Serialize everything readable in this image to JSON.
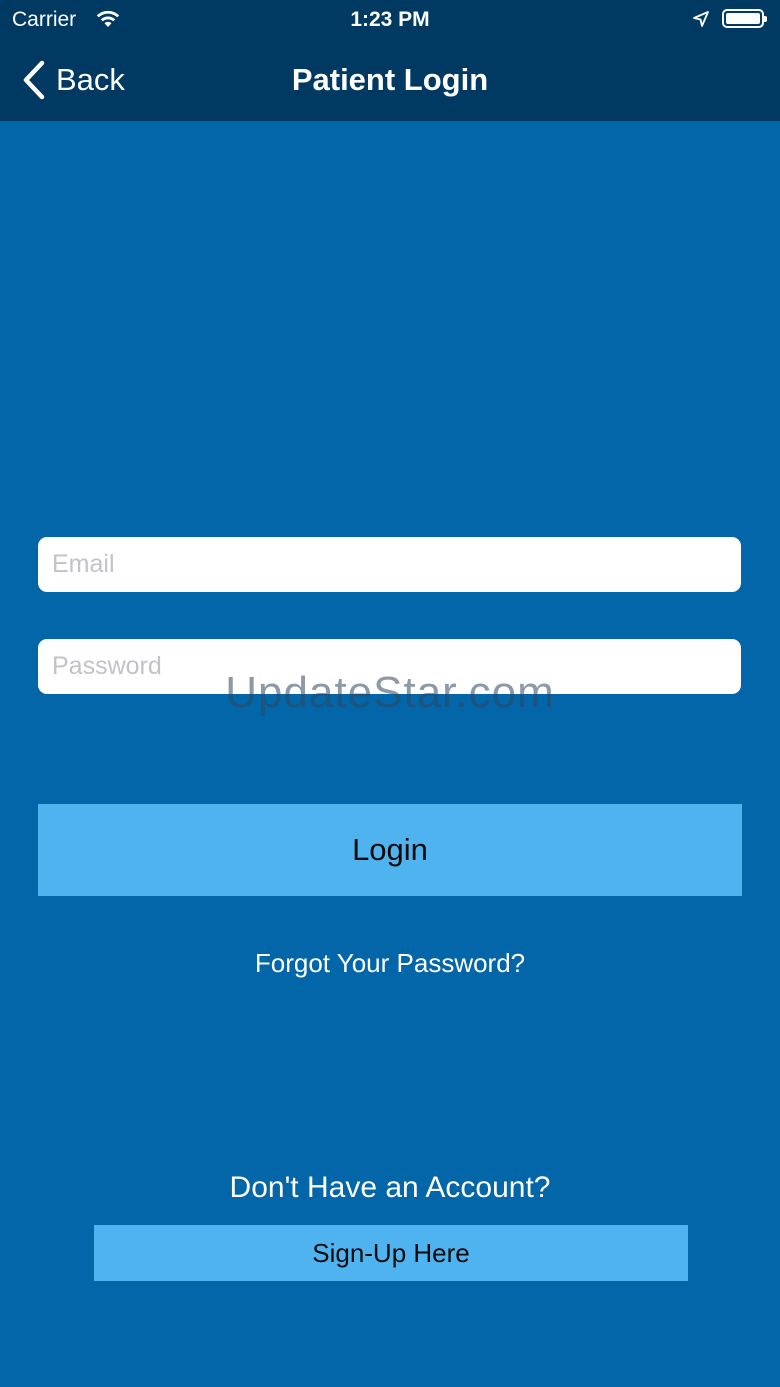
{
  "status_bar": {
    "carrier": "Carrier",
    "time": "1:23 PM",
    "icons": [
      "wifi-icon",
      "location-arrow-icon",
      "battery-icon"
    ]
  },
  "nav": {
    "back_label": "Back",
    "title": "Patient Login",
    "background": "#003a63"
  },
  "form": {
    "email_placeholder": "Email",
    "email_value": "",
    "password_placeholder": "Password",
    "password_value": ""
  },
  "watermark": "UpdateStar.com",
  "actions": {
    "login_label": "Login",
    "forgot_label": "Forgot Your Password?",
    "no_account_label": "Don't Have an Account?",
    "signup_label": "Sign-Up Here"
  },
  "colors": {
    "background": "#0266a8",
    "button": "#4fb3ef",
    "text": "#ffffff"
  }
}
